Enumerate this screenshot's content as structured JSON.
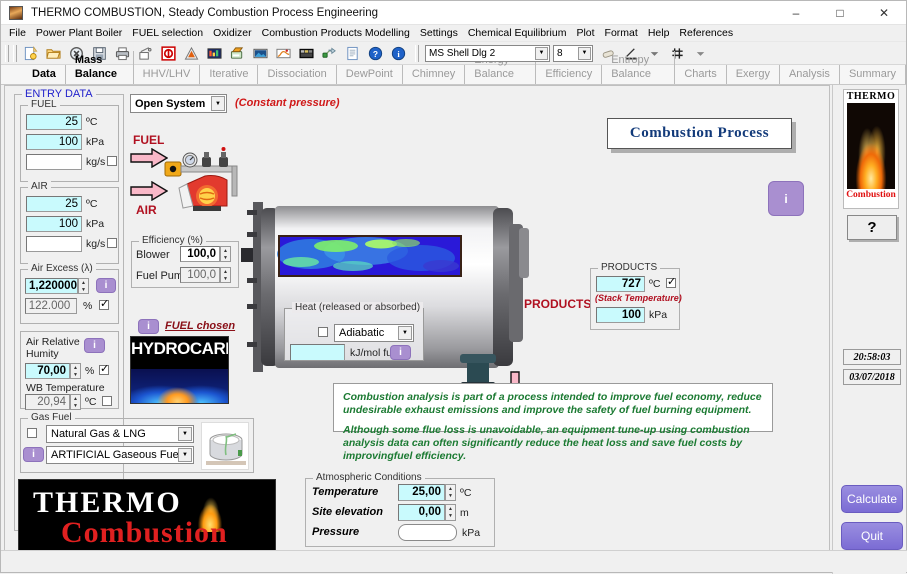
{
  "window": {
    "title": "THERMO COMBUSTION, Steady Combustion Process Engineering",
    "minimize": "–",
    "maximize": "□",
    "close": "✕"
  },
  "menu": [
    "File",
    "Power Plant Boiler",
    "FUEL selection",
    "Oxidizer",
    "Combustion Products Modelling",
    "Settings",
    "Chemical Equilibrium",
    "Plot",
    "Format",
    "Help",
    "References"
  ],
  "toolbar": {
    "icons": [
      "new-document-icon",
      "open-folder-icon",
      "cancel-icon",
      "save-icon",
      "print-icon",
      "print-preview-icon",
      "stop-icon",
      "warning-icon",
      "chart-icon",
      "scanner-icon",
      "photo-icon",
      "graph-icon",
      "table-icon",
      "export-icon",
      "report-icon",
      "help-icon",
      "info-icon"
    ],
    "font_name": "MS Shell Dlg 2",
    "font_size": "8",
    "eraser_icon": "eraser-icon",
    "pencil_icon": "pencil-underline-icon",
    "grid_icon": "hash-icon",
    "dropdown_glyph": "▼"
  },
  "tabs": [
    {
      "label": "Data",
      "active": true
    },
    {
      "label": "Mass Balance",
      "active": true
    },
    {
      "label": "HHV/LHV",
      "active": false
    },
    {
      "label": "Iterative",
      "active": false
    },
    {
      "label": "Dissociation",
      "active": false
    },
    {
      "label": "DewPoint",
      "active": false
    },
    {
      "label": "Chimney",
      "active": false
    },
    {
      "label": "Energy Balance",
      "active": false
    },
    {
      "label": "Efficiency",
      "active": false
    },
    {
      "label": "Entropy Balance",
      "active": false
    },
    {
      "label": "Charts",
      "active": false
    },
    {
      "label": "Exergy",
      "active": false
    },
    {
      "label": "Analysis",
      "active": false
    },
    {
      "label": "Summary",
      "active": false
    }
  ],
  "entry_data": {
    "legend": "ENTRY DATA",
    "fuel": {
      "legend": "FUEL",
      "temperature": "25",
      "temperature_unit": "ºC",
      "pressure": "100",
      "pressure_unit": "kPa",
      "massflow": "",
      "massflow_unit": "kg/s",
      "massflow_checked": false
    },
    "air": {
      "legend": "AIR",
      "temperature": "25",
      "temperature_unit": "ºC",
      "pressure": "100",
      "pressure_unit": "kPa",
      "massflow": "",
      "massflow_unit": "kg/s",
      "massflow_checked": false
    },
    "air_excess": {
      "legend": "Air Excess (λ)",
      "value": "1,220000",
      "percent": "122.000",
      "percent_unit": "%",
      "percent_checked": true,
      "info": "i"
    },
    "humidity": {
      "label_line1": "Air Relative",
      "label_line2": "Humity",
      "value": "70,00",
      "unit": "%",
      "checked": true,
      "wb_label": "WB Temperature",
      "wb_value": "20,94",
      "wb_unit": "ºC",
      "wb_checked": false,
      "info": "i"
    },
    "gas_fuel": {
      "legend": "Gas Fuel",
      "checkbox_checked": false,
      "option1": "Natural Gas & LNG",
      "option2": "ARTIFICIAL Gaseous Fuels",
      "info": "i",
      "tank_icon": "gas-tank-icon"
    }
  },
  "system": {
    "mode": "Open System",
    "note": "(Constant pressure)"
  },
  "burner": {
    "fuel_label": "FUEL",
    "air_label": "AIR",
    "fuel_arrow_icon": "arrow-right-icon",
    "air_arrow_icon": "arrow-right-icon",
    "burner_icon": "burner-icon"
  },
  "efficiency": {
    "legend": "Efficiency (%)",
    "blower_label": "Blower",
    "blower_value": "100,0",
    "fuelpump_label": "Fuel Pump",
    "fuelpump_value": "100,0"
  },
  "fuel_chosen": {
    "link": "FUEL chosen",
    "info": "i",
    "name": "HYDROCARBON"
  },
  "heat": {
    "legend": "Heat (released or absorbed)",
    "checked": false,
    "mode": "Adiabatic",
    "value": "",
    "unit": "kJ/mol fuel",
    "info": "i"
  },
  "products": {
    "legend": "PRODUCTS",
    "label": "PRODUCTS",
    "temperature": "727",
    "temperature_unit": "ºC",
    "temperature_checked": true,
    "caption": "(Stack Temperature)",
    "pressure": "100",
    "pressure_unit": "kPa",
    "arrow_icon": "arrow-down-icon"
  },
  "process_banner": "Combustion  Process",
  "process_info": "i",
  "notes": [
    "Combustion analysis is part of a process intended to improve fuel economy, reduce  undesirable exhaust emissions and improve the safety of fuel burning equipment.",
    "Although some flue loss is unavoidable, an equipment tune-up using combustion analysis data can often significantly reduce the heat loss and save fuel costs by improvingfuel efficiency."
  ],
  "atmospheric": {
    "legend": "Atmospheric Conditions",
    "rows": [
      {
        "label": "Temperature",
        "value": "25,00",
        "unit": "ºC",
        "spin": true,
        "blank": false
      },
      {
        "label": "Site elevation",
        "value": "0,00",
        "unit": "m",
        "spin": true,
        "blank": false
      },
      {
        "label": "Pressure",
        "value": "",
        "unit": "kPa",
        "spin": false,
        "blank": true
      }
    ]
  },
  "brand": {
    "line1": "THERMO",
    "line2": "Combustion",
    "flame_icon": "flame-icon"
  },
  "rightbar": {
    "thermo_title": "THERMO",
    "thermo_sub": "Combustion",
    "help_button": "?",
    "time": "20:58:03",
    "date": "03/07/2018",
    "calculate": "Calculate",
    "quit": "Quit"
  },
  "colors": {
    "accent_purple": "#a98fd0",
    "field_cyan": "#c9fafd",
    "red_label": "#b01020",
    "note_green": "#1b7a32",
    "banner_blue": "#123a7a"
  }
}
